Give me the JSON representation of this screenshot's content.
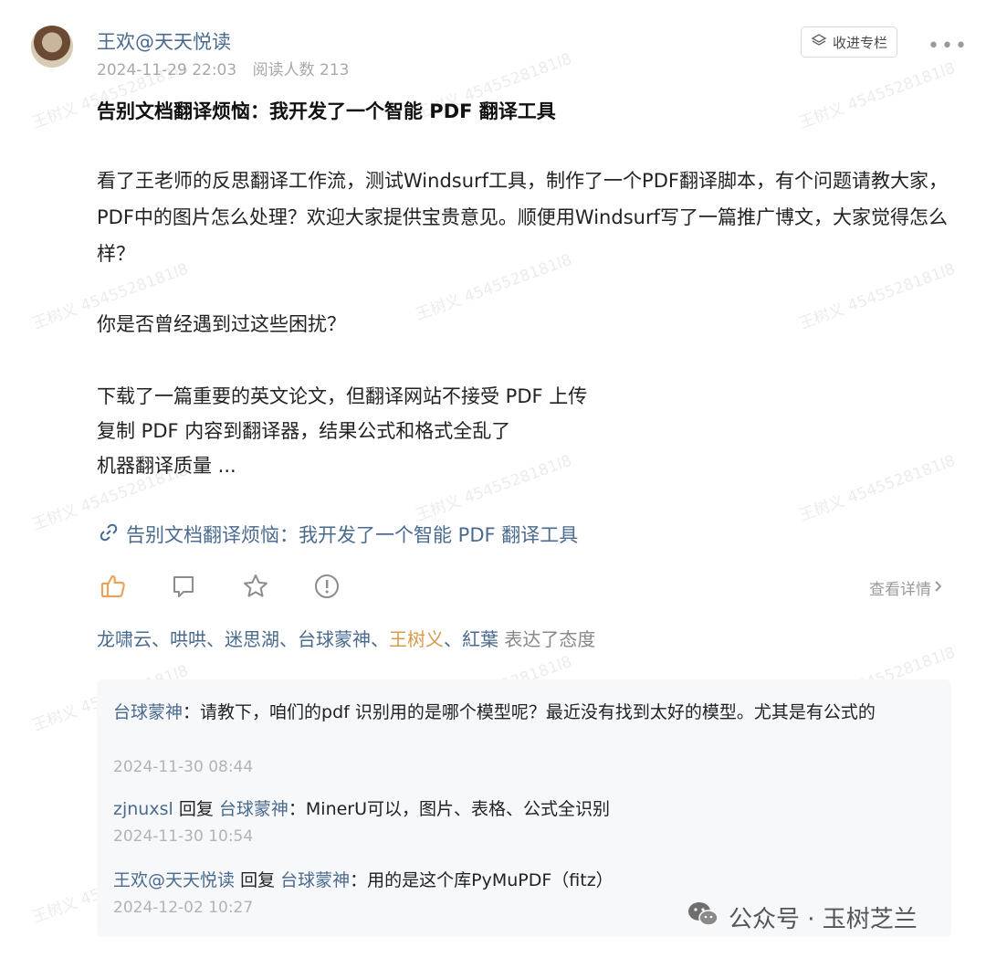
{
  "post": {
    "author": "王欢@天天悦读",
    "datetime": "2024-11-29 22:03",
    "readers": "阅读人数 213",
    "follow_label": "收进专栏",
    "more": "•••",
    "title": "告别文档翻译烦恼：我开发了一个智能 PDF 翻译工具",
    "body_para": "看了王老师的反思翻译工作流，测试Windsurf工具，制作了一个PDF翻译脚本，有个问题请教大家，PDF中的图片怎么处理？欢迎大家提供宝贵意见。顺便用Windsurf写了一篇推广博文，大家觉得怎么样？",
    "question": "你是否曾经遇到过这些困扰？",
    "line1": "下载了一篇重要的英文论文，但翻译网站不接受 PDF 上传",
    "line2": "复制 PDF 内容到翻译器，结果公式和格式全乱了",
    "line3": "机器翻译质量 ...",
    "link_text": "告别文档翻译烦恼：我开发了一个智能 PDF 翻译工具"
  },
  "actions": {
    "icons": [
      "thumbs-up-icon",
      "comment-icon",
      "star-icon",
      "report-icon"
    ],
    "details_label": "查看详情"
  },
  "reactions": {
    "names": [
      "龙啸云",
      "哄哄",
      "迷思湖",
      "台球蒙神",
      "王树义",
      "紅葉"
    ],
    "highlight": "王树义",
    "separator": "、",
    "tail": "表达了态度"
  },
  "comments": [
    {
      "user": "台球蒙神",
      "text": "：请教下，咱们的pdf 识别用的是哪个模型呢？最近没有找到太好的模型。尤其是有公式的",
      "time": "2024-11-30 08:44"
    },
    {
      "user": "zjnuxsl",
      "reply_word": "回复",
      "reply_to": "台球蒙神",
      "text": "：MinerU可以，图片、表格、公式全识别",
      "time": "2024-11-30 10:54"
    },
    {
      "user": "王欢@天天悦读",
      "reply_word": "回复",
      "reply_to": "台球蒙神",
      "text": "：用的是这个库PyMuPDF（fitz）",
      "time": "2024-12-02 10:27"
    }
  ],
  "watermark": "王树义 4545528181l8",
  "brand": {
    "label": "公众号 · 玉树芝兰"
  },
  "colors": {
    "link": "#4a6a8f",
    "highlight": "#d99a4a",
    "muted": "#a9a9a9"
  }
}
